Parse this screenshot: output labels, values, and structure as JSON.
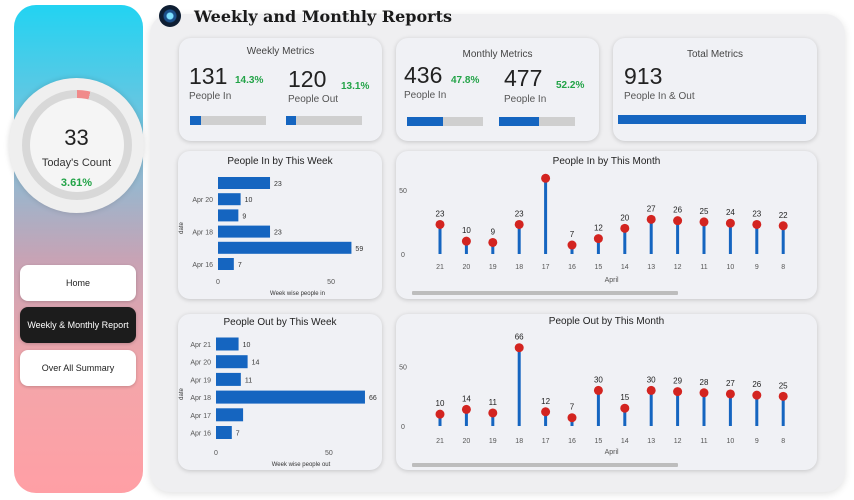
{
  "header": {
    "title": "Weekly and Monthly Reports",
    "logo_icon": "camera-lens-icon"
  },
  "sidebar": {
    "gauge": {
      "count": "33",
      "label": "Today's Count",
      "percent": "3.61%",
      "fill_fraction": 0.0361
    },
    "nav": [
      {
        "label": "Home",
        "active": false
      },
      {
        "label": "Weekly & Monthly Report",
        "active": true
      },
      {
        "label": "Over All Summary",
        "active": false
      }
    ]
  },
  "kpis": {
    "weekly": {
      "title": "Weekly Metrics",
      "in_value": "131",
      "in_pct": "14.3%",
      "in_label": "People In",
      "in_fill": 0.14,
      "out_value": "120",
      "out_pct": "13.1%",
      "out_label": "People Out",
      "out_fill": 0.13
    },
    "monthly": {
      "title": "Monthly Metrics",
      "in_value": "436",
      "in_pct": "47.8%",
      "in_label": "People In",
      "in_fill": 0.48,
      "out_value": "477",
      "out_pct": "52.2%",
      "out_label": "People In",
      "out_fill": 0.52
    },
    "total": {
      "title": "Total Metrics",
      "value": "913",
      "label": "People In & Out",
      "fill": 1.0
    }
  },
  "colors": {
    "bar": "#1565c0",
    "dot": "#d32420",
    "positive": "#22a347"
  },
  "chart_data": [
    {
      "id": "week_in",
      "type": "bar",
      "orientation": "horizontal",
      "title": "People In by This Week",
      "xlabel": "Week wise people in",
      "ylabel": "date",
      "categories": [
        "",
        "Apr 20",
        "",
        "Apr 18",
        "",
        "Apr 16"
      ],
      "values": [
        23,
        10,
        9,
        23,
        59,
        7
      ],
      "xticks": [
        0,
        50
      ],
      "xlim": [
        0,
        65
      ]
    },
    {
      "id": "month_in",
      "type": "lollipop",
      "title": "People In by This Month",
      "xlabel": "April",
      "categories": [
        "21",
        "20",
        "19",
        "18",
        "17",
        "16",
        "15",
        "14",
        "13",
        "12",
        "11",
        "10",
        "9",
        "8"
      ],
      "values": [
        23,
        10,
        9,
        23,
        59,
        7,
        12,
        20,
        27,
        26,
        25,
        24,
        23,
        22
      ],
      "label_values": [
        "23",
        "10",
        "9",
        "23",
        "",
        "7",
        "12",
        "20",
        "27",
        "26",
        "25",
        "24",
        "23",
        "22"
      ],
      "yticks": [
        0,
        50
      ],
      "ylim": [
        0,
        60
      ]
    },
    {
      "id": "week_out",
      "type": "bar",
      "orientation": "horizontal",
      "title": "People Out by This Week",
      "xlabel": "Week wise people out",
      "ylabel": "date",
      "categories": [
        "Apr 21",
        "Apr 20",
        "Apr 19",
        "Apr 18",
        "Apr 17",
        "Apr 16"
      ],
      "values": [
        10,
        14,
        11,
        66,
        12,
        7
      ],
      "label_values": [
        "10",
        "14",
        "11",
        "66",
        "",
        "7"
      ],
      "xticks": [
        0,
        50
      ],
      "xlim": [
        0,
        70
      ]
    },
    {
      "id": "month_out",
      "type": "lollipop",
      "title": "People Out by This Month",
      "xlabel": "April",
      "categories": [
        "21",
        "20",
        "19",
        "18",
        "17",
        "16",
        "15",
        "14",
        "13",
        "12",
        "11",
        "10",
        "9",
        "8"
      ],
      "values": [
        10,
        14,
        11,
        66,
        12,
        7,
        30,
        15,
        30,
        29,
        28,
        27,
        26,
        25
      ],
      "label_values": [
        "10",
        "14",
        "11",
        "66",
        "12",
        "7",
        "30",
        "15",
        "30",
        "29",
        "28",
        "27",
        "26",
        "25"
      ],
      "yticks": [
        0,
        50
      ],
      "ylim": [
        0,
        70
      ]
    }
  ]
}
